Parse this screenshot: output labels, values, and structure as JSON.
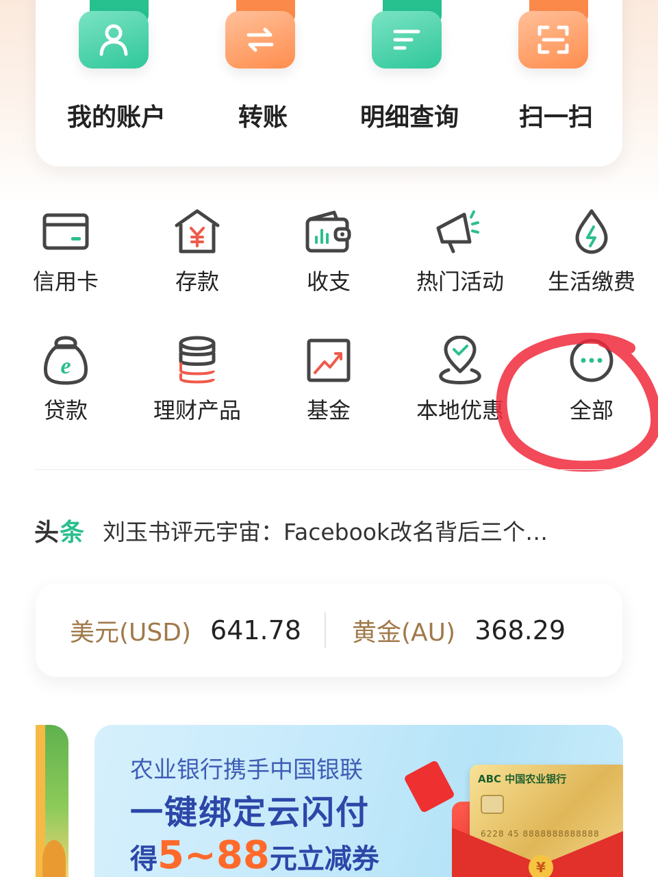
{
  "top_actions": [
    {
      "label": "我的账户",
      "icon": "user-icon",
      "theme": "green"
    },
    {
      "label": "转账",
      "icon": "transfer-icon",
      "theme": "orange"
    },
    {
      "label": "明细查询",
      "icon": "list-icon",
      "theme": "green"
    },
    {
      "label": "扫一扫",
      "icon": "scan-icon",
      "theme": "orange"
    }
  ],
  "services": [
    {
      "label": "信用卡",
      "icon": "credit-card-icon"
    },
    {
      "label": "存款",
      "icon": "deposit-icon"
    },
    {
      "label": "收支",
      "icon": "wallet-icon"
    },
    {
      "label": "热门活动",
      "icon": "megaphone-icon"
    },
    {
      "label": "生活缴费",
      "icon": "water-drop-icon"
    },
    {
      "label": "贷款",
      "icon": "loan-bag-icon"
    },
    {
      "label": "理财产品",
      "icon": "coin-stack-icon"
    },
    {
      "label": "基金",
      "icon": "trend-chart-icon"
    },
    {
      "label": "本地优惠",
      "icon": "location-pin-icon"
    },
    {
      "label": "全部",
      "icon": "more-icon"
    }
  ],
  "headline": {
    "tag_part1": "头",
    "tag_part2": "条",
    "text": "刘玉书评元宇宙：Facebook改名背后三个…"
  },
  "rates": [
    {
      "name": "美元(USD)",
      "value": "641.78"
    },
    {
      "name": "黄金(AU)",
      "value": "368.29"
    }
  ],
  "banner": {
    "line1": "农业银行携手中国银联",
    "line2": "一键绑定云闪付",
    "line3_pre": "得",
    "line3_amount": "5~88",
    "line3_unit": "元",
    "line3_post": "立减券",
    "card_bank": "ABC 中国农业银行",
    "card_number": "6228 45 8888888888888",
    "coin_symbol": "¥"
  },
  "colors": {
    "accent_green": "#2bbf8c",
    "accent_orange": "#ff8d4d",
    "rate_label": "#a0794a",
    "annotation_red": "#f02a3c"
  }
}
